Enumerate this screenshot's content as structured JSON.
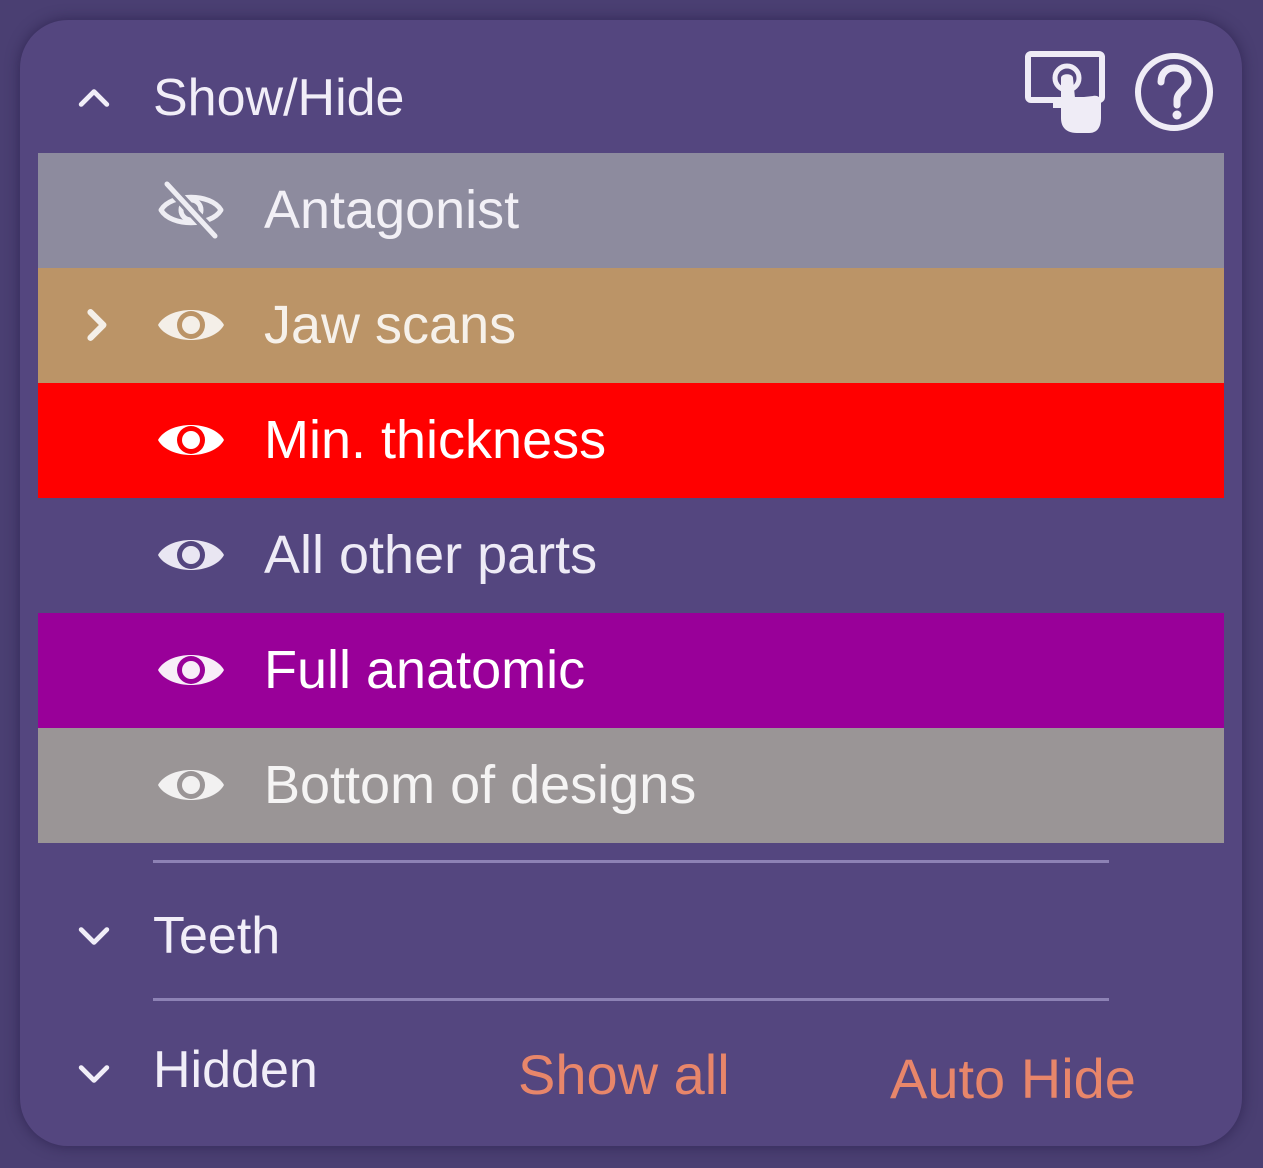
{
  "sections": {
    "show_hide": {
      "title": "Show/Hide",
      "expanded": true
    },
    "teeth": {
      "title": "Teeth",
      "expanded": false
    },
    "hidden": {
      "title": "Hidden",
      "expanded": false
    }
  },
  "header_icons": [
    "touch-screen-icon",
    "help-icon"
  ],
  "items": [
    {
      "label": "Antagonist",
      "visible": false,
      "expandable": false,
      "bg": "#8d8b9e",
      "text_color": "#f2f0f6",
      "eye_color": "#eeedf3"
    },
    {
      "label": "Jaw scans",
      "visible": true,
      "expandable": true,
      "bg": "#bb9467",
      "text_color": "#f6f1ea",
      "eye_color": "#f4efe8"
    },
    {
      "label": "Min. thickness",
      "visible": true,
      "expandable": false,
      "bg": "#ff0000",
      "text_color": "#ffffff",
      "eye_color": "#ffffff"
    },
    {
      "label": "All other parts",
      "visible": true,
      "expandable": false,
      "bg": "#54467f",
      "text_color": "#eeebf6",
      "eye_color": "#e9e6f2"
    },
    {
      "label": "Full anatomic",
      "visible": true,
      "expandable": false,
      "bg": "#990099",
      "text_color": "#ffffff",
      "eye_color": "#f8eef8"
    },
    {
      "label": "Bottom of designs",
      "visible": true,
      "expandable": false,
      "bg": "#9a9596",
      "text_color": "#f5f4f4",
      "eye_color": "#f2f1f1"
    }
  ],
  "actions": {
    "show_all": "Show all",
    "auto_hide": "Auto Hide"
  },
  "colors": {
    "panel_bg": "#54467f",
    "accent": "#e8866a",
    "text": "#f1eef8"
  }
}
